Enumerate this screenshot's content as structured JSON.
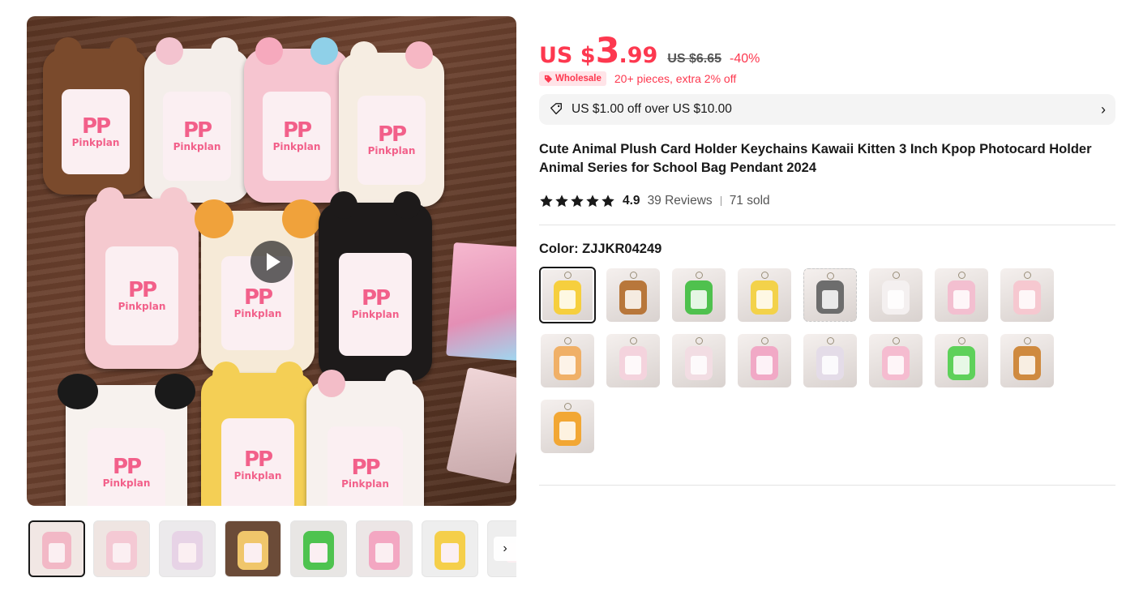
{
  "gallery": {
    "main_image_label": "Cute animal plush photocard holders",
    "brand_mark": "PP",
    "brand_name": "Pinkplan",
    "thumbnails": [
      {
        "color": "#f2b8c6",
        "active": true
      },
      {
        "color": "#f4c9d4"
      },
      {
        "color": "#e7d3e6"
      },
      {
        "color": "#f0c66b"
      },
      {
        "color": "#4ec34f"
      },
      {
        "color": "#f3a7c2"
      },
      {
        "color": "#f5cf4a"
      },
      {
        "color": "#eeeeee"
      }
    ],
    "next_icon": "chevron-right-icon"
  },
  "price": {
    "currency": "US $",
    "integer": "3",
    "decimal": ".99",
    "original": "US $6.65",
    "discount": "-40%"
  },
  "wholesale": {
    "badge_label": "Wholesale",
    "text": "20+ pieces, extra 2% off"
  },
  "coupon": {
    "text": "US $1.00 off over US $10.00",
    "icon": "ticket-icon"
  },
  "product": {
    "title": "Cute Animal Plush Card Holder Keychains Kawaii Kitten 3 Inch Kpop Photocard Holder Animal Series for School Bag Pendant 2024",
    "rating": "4.9",
    "stars": 5,
    "reviews": "39 Reviews",
    "sold": "71 sold"
  },
  "color": {
    "label": "Color: ZJJKR04249",
    "options": [
      {
        "color": "#f6cf3e",
        "selected": true
      },
      {
        "color": "#b8773b"
      },
      {
        "color": "#4fc14e"
      },
      {
        "color": "#f3d24a"
      },
      {
        "color": "#6d6d6d",
        "dashed": true
      },
      {
        "color": "#f4f0f0"
      },
      {
        "color": "#f3bfd0"
      },
      {
        "color": "#f6c8d0"
      },
      {
        "color": "#f0b067"
      },
      {
        "color": "#f4d3dd"
      },
      {
        "color": "#f2dde3"
      },
      {
        "color": "#f1a9c6"
      },
      {
        "color": "#e4dce8"
      },
      {
        "color": "#f5bcd0"
      },
      {
        "color": "#5ed15a"
      },
      {
        "color": "#cf8a3f"
      },
      {
        "color": "#f2a734"
      }
    ]
  }
}
